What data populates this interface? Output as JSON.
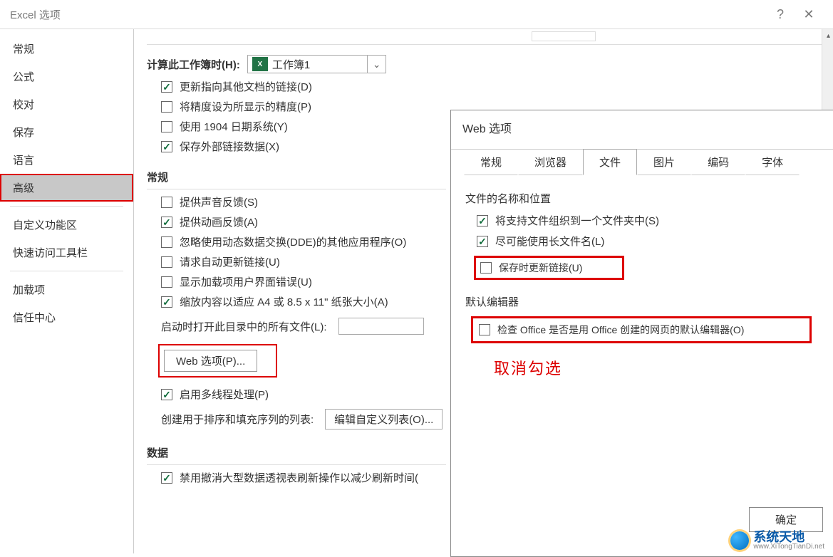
{
  "window": {
    "title": "Excel 选项",
    "help_icon": "?",
    "close_icon": "✕"
  },
  "sidebar": {
    "items": [
      {
        "label": "常规"
      },
      {
        "label": "公式"
      },
      {
        "label": "校对"
      },
      {
        "label": "保存"
      },
      {
        "label": "语言"
      },
      {
        "label": "高级",
        "selected": true
      },
      {
        "label": "自定义功能区"
      },
      {
        "label": "快速访问工具栏"
      },
      {
        "label": "加载项"
      },
      {
        "label": "信任中心"
      }
    ]
  },
  "content": {
    "calc_label": "计算此工作簿时(H):",
    "workbook_name": "工作簿1",
    "calc_opts": [
      {
        "checked": true,
        "label": "更新指向其他文档的链接(D)"
      },
      {
        "checked": false,
        "label": "将精度设为所显示的精度(P)"
      },
      {
        "checked": false,
        "label": "使用 1904 日期系统(Y)"
      },
      {
        "checked": true,
        "label": "保存外部链接数据(X)"
      }
    ],
    "general_header": "常规",
    "general_opts": [
      {
        "checked": false,
        "label": "提供声音反馈(S)"
      },
      {
        "checked": true,
        "label": "提供动画反馈(A)"
      },
      {
        "checked": false,
        "label": "忽略使用动态数据交换(DDE)的其他应用程序(O)"
      },
      {
        "checked": false,
        "label": "请求自动更新链接(U)"
      },
      {
        "checked": false,
        "label": "显示加载项用户界面错误(U)"
      },
      {
        "checked": true,
        "label": "缩放内容以适应 A4 或 8.5 x 11\" 纸张大小(A)"
      }
    ],
    "startup_label": "启动时打开此目录中的所有文件(L):",
    "web_options_btn": "Web 选项(P)...",
    "multithread": {
      "checked": true,
      "label": "启用多线程处理(P)"
    },
    "lists_label": "创建用于排序和填充序列的列表:",
    "lists_btn": "编辑自定义列表(O)...",
    "data_header": "数据",
    "data_opt": {
      "checked": true,
      "label": "禁用撤消大型数据透视表刷新操作以减少刷新时间("
    }
  },
  "web_dialog": {
    "title": "Web 选项",
    "tabs": [
      "常规",
      "浏览器",
      "文件",
      "图片",
      "编码",
      "字体"
    ],
    "active_tab": "文件",
    "group1_title": "文件的名称和位置",
    "g1_opts": [
      {
        "checked": true,
        "label": "将支持文件组织到一个文件夹中(S)"
      },
      {
        "checked": true,
        "label": "尽可能使用长文件名(L)"
      },
      {
        "checked": false,
        "label": "保存时更新链接(U)",
        "highlight": true
      }
    ],
    "group2_title": "默认编辑器",
    "g2_opt": {
      "checked": false,
      "label": "检查 Office 是否是用 Office 创建的网页的默认编辑器(O)"
    },
    "annotation": "取消勾选",
    "ok_btn": "确定"
  },
  "watermark": {
    "line1": "系统天地",
    "line2": "www.XiTongTianDi.net"
  }
}
